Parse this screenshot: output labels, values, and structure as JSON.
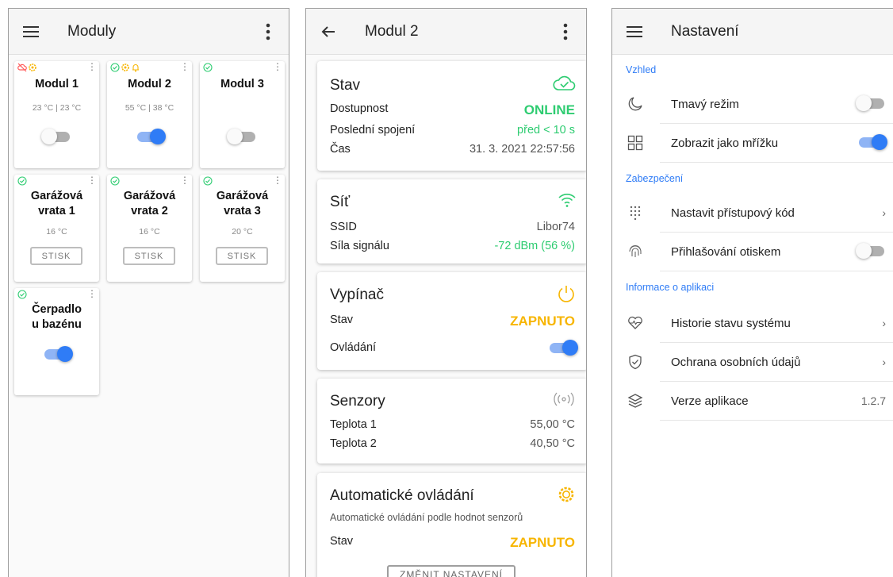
{
  "colors": {
    "accent": "#2f7cf6",
    "online": "#2ecc71",
    "warning": "#f7b500",
    "offline": "#ff5a5a"
  },
  "screen1": {
    "title": "Moduly",
    "modules": [
      {
        "name": "Modul 1",
        "temp": "23 °C | 23 °C",
        "type": "switch",
        "on": false,
        "status_icons": [
          "cloud-off-icon",
          "gear-warning-icon"
        ]
      },
      {
        "name": "Modul 2",
        "temp": "55 °C | 38 °C",
        "type": "switch",
        "on": true,
        "status_icons": [
          "check-circle-icon",
          "gear-warning-icon",
          "bell-icon"
        ]
      },
      {
        "name": "Modul 3",
        "temp": "",
        "type": "switch",
        "on": false,
        "status_icons": [
          "check-circle-icon"
        ]
      },
      {
        "name": "Garážová vrata 1",
        "temp": "16 °C",
        "type": "button",
        "button_label": "STISK",
        "status_icons": [
          "check-circle-icon"
        ]
      },
      {
        "name": "Garážová vrata 2",
        "temp": "16 °C",
        "type": "button",
        "button_label": "STISK",
        "status_icons": [
          "check-circle-icon"
        ]
      },
      {
        "name": "Garážová vrata 3",
        "temp": "20 °C",
        "type": "button",
        "button_label": "STISK",
        "status_icons": [
          "check-circle-icon"
        ]
      },
      {
        "name": "Čerpadlo u bazénu",
        "temp": "",
        "type": "switch",
        "on": true,
        "status_icons": [
          "check-circle-icon"
        ]
      }
    ],
    "names_split": [
      [
        "Modul 1"
      ],
      [
        "Modul 2"
      ],
      [
        "Modul 3"
      ],
      [
        "Garážová",
        "vrata 1"
      ],
      [
        "Garážová",
        "vrata 2"
      ],
      [
        "Garážová",
        "vrata 3"
      ],
      [
        "Čerpadlo",
        "u bazénu"
      ]
    ]
  },
  "screen2": {
    "title": "Modul 2",
    "stav": {
      "title": "Stav",
      "rows": [
        {
          "label": "Dostupnost",
          "value": "ONLINE"
        },
        {
          "label": "Poslední spojení",
          "value": "před < 10 s"
        },
        {
          "label": "Čas",
          "value": "31. 3. 2021 22:57:56"
        }
      ]
    },
    "sit": {
      "title": "Síť",
      "rows": [
        {
          "label": "SSID",
          "value": "Libor74"
        },
        {
          "label": "Síla signálu",
          "value": "-72 dBm (56 %)"
        }
      ]
    },
    "vypinac": {
      "title": "Vypínač",
      "stav_label": "Stav",
      "stav_value": "ZAPNUTO",
      "ovladani_label": "Ovládání",
      "ovladani_on": true
    },
    "senzory": {
      "title": "Senzory",
      "rows": [
        {
          "label": "Teplota 1",
          "value": "55,00 °C"
        },
        {
          "label": "Teplota 2",
          "value": "40,50 °C"
        }
      ]
    },
    "auto": {
      "title": "Automatické ovládání",
      "description": "Automatické ovládání podle hodnot senzorů",
      "stav_label": "Stav",
      "stav_value": "ZAPNUTO",
      "button_label": "ZMĚNIT NASTAVENÍ"
    }
  },
  "screen3": {
    "title": "Nastavení",
    "sections": {
      "vzhled": "Vzhled",
      "zabezpeceni": "Zabezpečení",
      "informace": "Informace o aplikaci"
    },
    "items": {
      "dark_mode": {
        "label": "Tmavý režim",
        "on": false
      },
      "grid": {
        "label": "Zobrazit jako mřížku",
        "on": true
      },
      "access_code": {
        "label": "Nastavit přístupový kód"
      },
      "fingerprint": {
        "label": "Přihlašování otiskem",
        "on": false
      },
      "history": {
        "label": "Historie stavu systému"
      },
      "privacy": {
        "label": "Ochrana osobních údajů"
      },
      "version": {
        "label": "Verze aplikace",
        "value": "1.2.7"
      }
    }
  }
}
